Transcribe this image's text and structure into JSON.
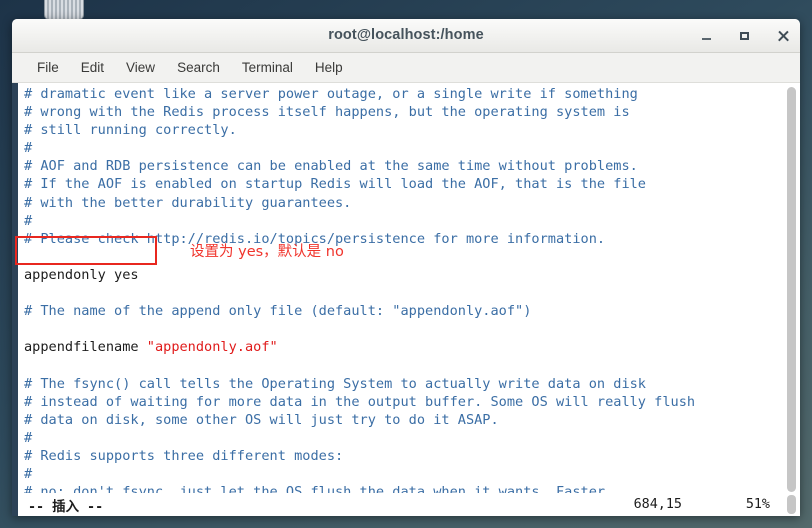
{
  "window": {
    "title": "root@localhost:/home",
    "buttons": {
      "minimize": "minimize",
      "maximize": "maximize",
      "close": "close"
    }
  },
  "menubar": {
    "items": [
      {
        "label": "File"
      },
      {
        "label": "Edit"
      },
      {
        "label": "View"
      },
      {
        "label": "Search"
      },
      {
        "label": "Terminal"
      },
      {
        "label": "Help"
      }
    ]
  },
  "terminal": {
    "lines": [
      {
        "segments": [
          {
            "text": "# dramatic event like a server power outage, or a single write if something",
            "style": "comment"
          }
        ]
      },
      {
        "segments": [
          {
            "text": "# wrong with the Redis process itself happens, but the operating system is",
            "style": "comment"
          }
        ]
      },
      {
        "segments": [
          {
            "text": "# still running correctly.",
            "style": "comment"
          }
        ]
      },
      {
        "segments": [
          {
            "text": "#",
            "style": "comment"
          }
        ]
      },
      {
        "segments": [
          {
            "text": "# AOF and RDB persistence can be enabled at the same time without problems.",
            "style": "comment"
          }
        ]
      },
      {
        "segments": [
          {
            "text": "# If the AOF is enabled on startup Redis will load the AOF, that is the file",
            "style": "comment"
          }
        ]
      },
      {
        "segments": [
          {
            "text": "# with the better durability guarantees.",
            "style": "comment"
          }
        ]
      },
      {
        "segments": [
          {
            "text": "#",
            "style": "comment"
          }
        ]
      },
      {
        "segments": [
          {
            "text": "# Please check http://redis.io/topics/persistence for more information.",
            "style": "comment"
          }
        ]
      },
      {
        "segments": [
          {
            "text": "",
            "style": "blank"
          }
        ]
      },
      {
        "segments": [
          {
            "text": "appendonly yes",
            "style": "plain"
          }
        ]
      },
      {
        "segments": [
          {
            "text": "",
            "style": "blank"
          }
        ]
      },
      {
        "segments": [
          {
            "text": "# The name of the append only file (default: \"appendonly.aof\")",
            "style": "comment"
          }
        ]
      },
      {
        "segments": [
          {
            "text": "",
            "style": "blank"
          }
        ]
      },
      {
        "segments": [
          {
            "text": "appendfilename ",
            "style": "plain"
          },
          {
            "text": "\"appendonly.aof\"",
            "style": "string"
          }
        ]
      },
      {
        "segments": [
          {
            "text": "",
            "style": "blank"
          }
        ]
      },
      {
        "segments": [
          {
            "text": "# The fsync() call tells the Operating System to actually write data on disk",
            "style": "comment"
          }
        ]
      },
      {
        "segments": [
          {
            "text": "# instead of waiting for more data in the output buffer. Some OS will really flush",
            "style": "comment"
          }
        ]
      },
      {
        "segments": [
          {
            "text": "# data on disk, some other OS will just try to do it ASAP.",
            "style": "comment"
          }
        ]
      },
      {
        "segments": [
          {
            "text": "#",
            "style": "comment"
          }
        ]
      },
      {
        "segments": [
          {
            "text": "# Redis supports three different modes:",
            "style": "comment"
          }
        ]
      },
      {
        "segments": [
          {
            "text": "#",
            "style": "comment"
          }
        ]
      },
      {
        "segments": [
          {
            "text": "# no: don't fsync, just let the OS flush the data when it wants. Faster.",
            "style": "comment"
          }
        ]
      }
    ]
  },
  "annotation": {
    "note": "设置为 yes，默认是 no",
    "highlight_target": "appendonly yes",
    "color": "#f0342c"
  },
  "statusbar": {
    "mode": "-- 插入 --",
    "position": "684,15",
    "percent": "51%"
  },
  "colors": {
    "comment": "#3b6ea5",
    "string": "#e01b1b",
    "plain": "#1c1c1c",
    "annotation": "#f0342c",
    "desktop": "#2e4a5c"
  }
}
